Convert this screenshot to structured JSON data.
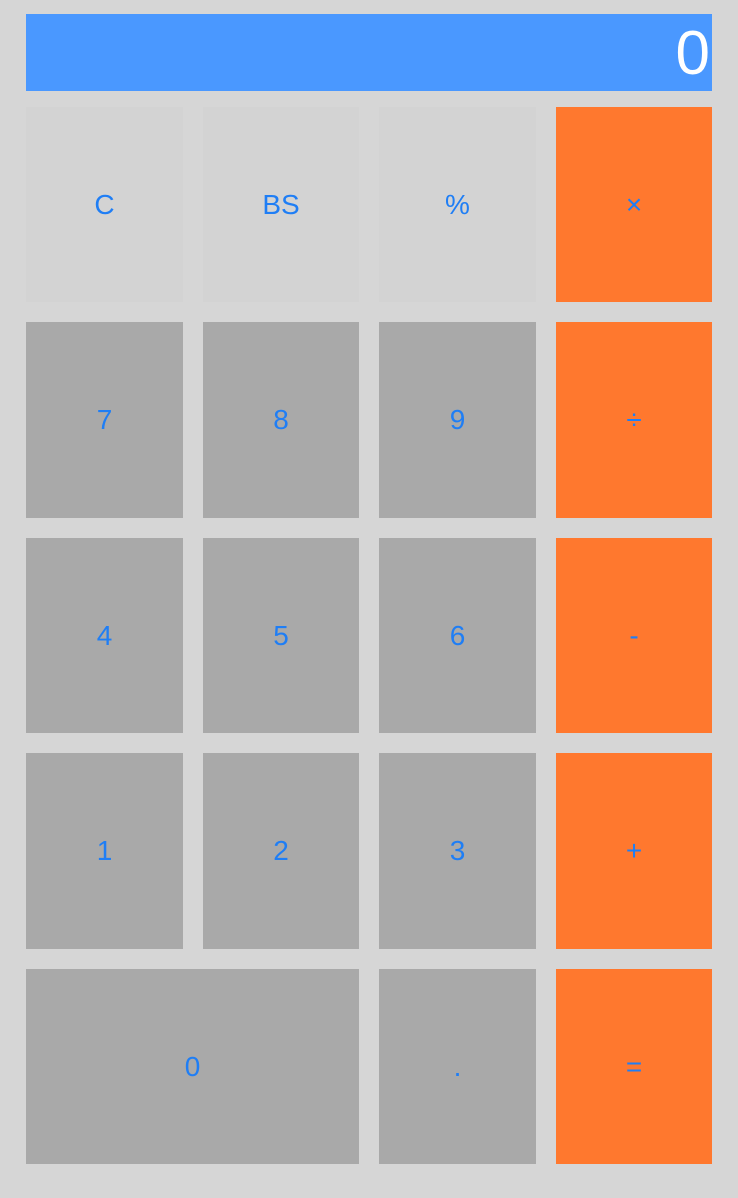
{
  "display": {
    "value": "0"
  },
  "keys": {
    "clear": "C",
    "backspace": "BS",
    "percent": "%",
    "multiply": "×",
    "seven": "7",
    "eight": "8",
    "nine": "9",
    "divide": "÷",
    "four": "4",
    "five": "5",
    "six": "6",
    "subtract": "-",
    "one": "1",
    "two": "2",
    "three": "3",
    "add": "+",
    "zero": "0",
    "decimal": ".",
    "equals": "="
  },
  "colors": {
    "background": "#d6d6d6",
    "display_bg": "#4a98ff",
    "display_text": "#ffffff",
    "function_key": "#d3d3d3",
    "number_key": "#a9a9a9",
    "operator_key": "#ff782e",
    "key_text": "#1f7ef5"
  }
}
